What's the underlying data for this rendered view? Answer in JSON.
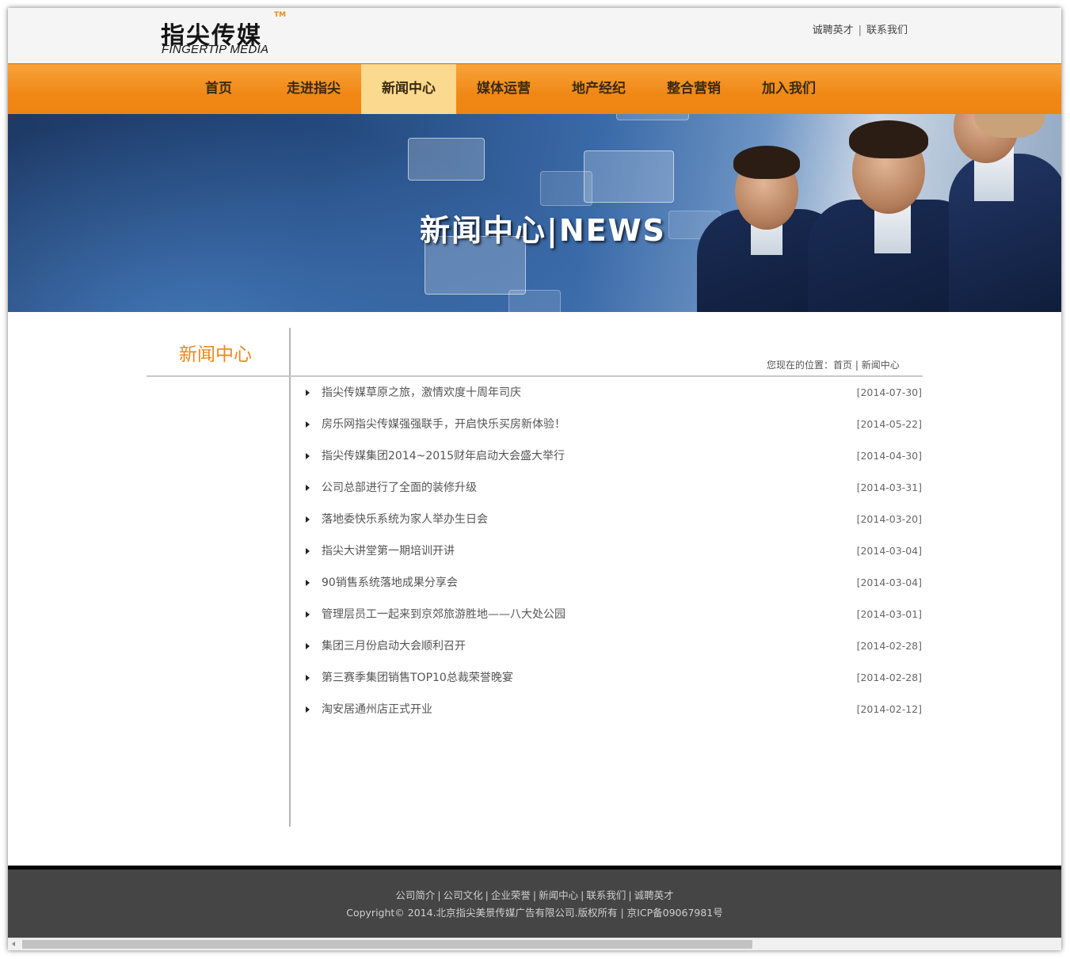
{
  "logo": {
    "cn": "指尖传媒",
    "tm": "TM",
    "en": "FINGERTIP MEDIA"
  },
  "top_links": [
    {
      "label": "诚聘英才"
    },
    {
      "label": "联系我们"
    }
  ],
  "top_links_sep": "|",
  "nav": {
    "items": [
      {
        "label": "首页"
      },
      {
        "label": "走进指尖"
      },
      {
        "label": "新闻中心",
        "active": true
      },
      {
        "label": "媒体运营"
      },
      {
        "label": "地产经纪"
      },
      {
        "label": "整合营销"
      },
      {
        "label": "加入我们"
      }
    ],
    "colors": {
      "bar": "#f08816",
      "active": "#fbd98e"
    }
  },
  "banner": {
    "title": "新闻中心|NEWS"
  },
  "sidebar": {
    "title": "新闻中心"
  },
  "breadcrumb": {
    "prefix": "您现在的位置：",
    "home": "首页",
    "sep": " | ",
    "current": "新闻中心"
  },
  "news": [
    {
      "title": "指尖传媒草原之旅，激情欢度十周年司庆",
      "date": "[2014-07-30]"
    },
    {
      "title": "房乐网指尖传媒强强联手，开启快乐买房新体验！",
      "date": "[2014-05-22]"
    },
    {
      "title": "指尖传媒集团2014~2015财年启动大会盛大举行",
      "date": "[2014-04-30]"
    },
    {
      "title": "公司总部进行了全面的装修升级",
      "date": "[2014-03-31]"
    },
    {
      "title": "落地委快乐系统为家人举办生日会",
      "date": "[2014-03-20]"
    },
    {
      "title": "指尖大讲堂第一期培训开讲",
      "date": "[2014-03-04]"
    },
    {
      "title": "90销售系统落地成果分享会",
      "date": "[2014-03-04]"
    },
    {
      "title": "管理层员工一起来到京郊旅游胜地——八大处公园",
      "date": "[2014-03-01]"
    },
    {
      "title": "集团三月份启动大会顺利召开",
      "date": "[2014-02-28]"
    },
    {
      "title": "第三赛季集团销售TOP10总裁荣誉晚宴",
      "date": "[2014-02-28]"
    },
    {
      "title": "淘安居通州店正式开业",
      "date": "[2014-02-12]"
    }
  ],
  "footer": {
    "links": [
      {
        "label": "公司简介"
      },
      {
        "label": "公司文化"
      },
      {
        "label": "企业荣誉"
      },
      {
        "label": "新闻中心"
      },
      {
        "label": "联系我们"
      },
      {
        "label": "诚聘英才"
      }
    ],
    "sep": "|",
    "copyright": "Copyright© 2014.北京指尖美景传媒广告有限公司.版权所有 | 京ICP备09067981号"
  },
  "icons": {
    "news_bullet": "triangle-right-icon",
    "scroll_left": "arrow-left-icon"
  },
  "scrollbar": {
    "horizontal_thumb_fraction": 0.69
  }
}
